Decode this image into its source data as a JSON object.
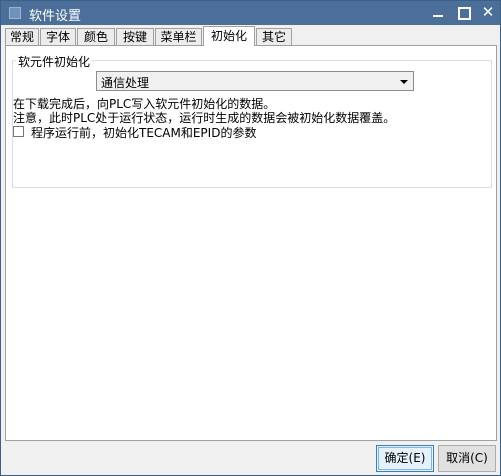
{
  "window": {
    "title": "软件设置"
  },
  "titlebar": {
    "minimize": "—",
    "maximize": "□",
    "close": "✕"
  },
  "tabs": [
    {
      "label": "常规"
    },
    {
      "label": "字体"
    },
    {
      "label": "颜色"
    },
    {
      "label": "按键"
    },
    {
      "label": "菜单栏"
    },
    {
      "label": "初始化",
      "active": true
    },
    {
      "label": "其它"
    }
  ],
  "init_group": {
    "title": "软元件初始化",
    "combo_value": "通信处理",
    "line1": "在下载完成后，向PLC写入软元件初始化的数据。",
    "line2": "注意，此时PLC处于运行状态，运行时生成的数据会被初始化数据覆盖。",
    "checkbox_label": "程序运行前，初始化TECAM和EPID的参数",
    "checkbox_checked": false
  },
  "buttons": {
    "ok": "确定(E)",
    "cancel": "取消(C)"
  }
}
